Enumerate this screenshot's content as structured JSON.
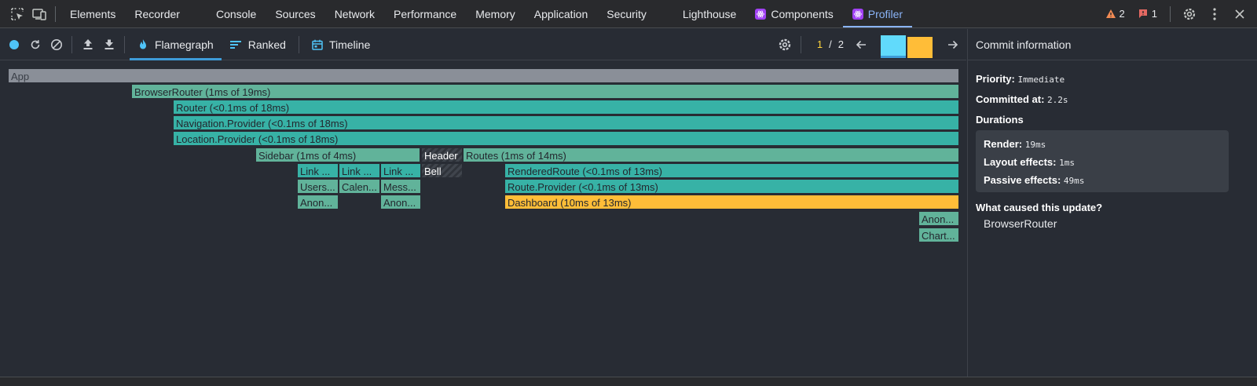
{
  "devtools": {
    "tabs": [
      {
        "label": "Elements"
      },
      {
        "label": "Recorder"
      },
      {
        "label": "Console"
      },
      {
        "label": "Sources"
      },
      {
        "label": "Network"
      },
      {
        "label": "Performance"
      },
      {
        "label": "Memory"
      },
      {
        "label": "Application"
      },
      {
        "label": "Security"
      },
      {
        "label": "Lighthouse"
      },
      {
        "label": "Components"
      },
      {
        "label": "Profiler"
      }
    ],
    "active_tab": "Profiler",
    "warnings_count": "2",
    "errors_count": "1"
  },
  "profiler": {
    "tabs": {
      "flamegraph": "Flamegraph",
      "ranked": "Ranked",
      "timeline": "Timeline"
    },
    "commit_current": "1",
    "commit_separator": "/",
    "commit_total": "2",
    "commits": [
      {
        "color": "#61dafb",
        "selected": true,
        "level": 0.95
      },
      {
        "color": "#ffbd38",
        "selected": false,
        "level": 0.9
      }
    ],
    "colors": {
      "recording": "#4fc3f7",
      "accent": "#3e9cd8"
    }
  },
  "flamegraph": {
    "nodes": [
      {
        "label": "App",
        "style": "gray"
      },
      {
        "label": "BrowserRouter (1ms of 19ms)",
        "style": "teal1"
      },
      {
        "label": "Router (<0.1ms of 18ms)",
        "style": "teal2"
      },
      {
        "label": "Navigation.Provider (<0.1ms of 18ms)",
        "style": "teal2"
      },
      {
        "label": "Location.Provider (<0.1ms of 18ms)",
        "style": "teal2"
      },
      {
        "label": "Sidebar (1ms of 4ms)",
        "style": "teal1"
      },
      {
        "label": "Header",
        "style": "hatch"
      },
      {
        "label": "Routes (1ms of 14ms)",
        "style": "teal1"
      },
      {
        "label": "Link ...",
        "style": "teal2"
      },
      {
        "label": "Link ...",
        "style": "teal2"
      },
      {
        "label": "Link ...",
        "style": "teal2"
      },
      {
        "label": "Bell",
        "style": "hatch"
      },
      {
        "label": "RenderedRoute (<0.1ms of 13ms)",
        "style": "teal2"
      },
      {
        "label": "Users...",
        "style": "teal1"
      },
      {
        "label": "Calen...",
        "style": "teal1"
      },
      {
        "label": "Mess...",
        "style": "teal1"
      },
      {
        "label": "Route.Provider (<0.1ms of 13ms)",
        "style": "teal2"
      },
      {
        "label": "Anon...",
        "style": "teal1"
      },
      {
        "label": "Anon...",
        "style": "teal1"
      },
      {
        "label": "Dashboard (10ms of 13ms)",
        "style": "yellow"
      },
      {
        "label": "Anon...",
        "style": "teal1"
      },
      {
        "label": "Chart...",
        "style": "teal1"
      }
    ]
  },
  "sidebar": {
    "title": "Commit information",
    "priority_label": "Priority",
    "priority_value": "Immediate",
    "committed_label": "Committed at",
    "committed_value": "2.2s",
    "durations_label": "Durations",
    "render_label": "Render",
    "render_value": "19ms",
    "layout_label": "Layout effects",
    "layout_value": "1ms",
    "passive_label": "Passive effects",
    "passive_value": "49ms",
    "cause_label": "What caused this update?",
    "cause_items": [
      "BrowserRouter"
    ]
  }
}
